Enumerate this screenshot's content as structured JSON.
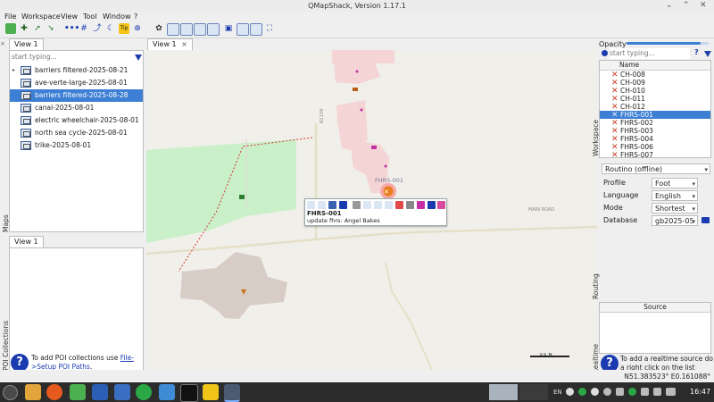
{
  "window": {
    "title": "QMapShack, Version 1.17.1"
  },
  "menu": [
    "File",
    "Workspace",
    "View",
    "Tool",
    "Window",
    "?"
  ],
  "maps_panel": {
    "tab": "View 1",
    "search_placeholder": "start typing...",
    "dock_label": "Maps",
    "items": [
      {
        "label": "barriers filtered-2025-08-21",
        "selected": false,
        "expander": true
      },
      {
        "label": "ave-verte-large-2025-08-01",
        "selected": false,
        "expander": false
      },
      {
        "label": "barriers filtered-2025-08-28",
        "selected": true,
        "expander": false
      },
      {
        "label": "canal-2025-08-01",
        "selected": false,
        "expander": false
      },
      {
        "label": "electric wheelchair-2025-08-01",
        "selected": false,
        "expander": false
      },
      {
        "label": "north sea cycle-2025-08-01",
        "selected": false,
        "expander": false
      },
      {
        "label": "trike-2025-08-01",
        "selected": false,
        "expander": false
      }
    ]
  },
  "poi_panel": {
    "tab": "View 1",
    "dock_label": "POI Collections",
    "help_text": "To add POI collections use ",
    "help_link": "File->Setup POI Paths",
    "help_end": "."
  },
  "map_view": {
    "tab": "View 1",
    "tab_close": "×",
    "road_label_1": "B1139",
    "road_label_2": "MAIN ROAD",
    "marker_label": "FHRS-001",
    "popup": {
      "title": "FHRS-001",
      "subtitle": "update fhrs: Angel Bakes"
    },
    "scale": "33 ft"
  },
  "workspace": {
    "opacity_label": "Opacity",
    "opacity_value": 0.9,
    "search_placeholder": "start typing...",
    "help_glyph": "?",
    "dock_label": "Workspace",
    "column_name": "Name",
    "items": [
      {
        "label": "CH-008",
        "selected": false
      },
      {
        "label": "CH-009",
        "selected": false
      },
      {
        "label": "CH-010",
        "selected": false
      },
      {
        "label": "CH-011",
        "selected": false
      },
      {
        "label": "CH-012",
        "selected": false
      },
      {
        "label": "FHRS-001",
        "selected": true
      },
      {
        "label": "FHRS-002",
        "selected": false
      },
      {
        "label": "FHRS-003",
        "selected": false
      },
      {
        "label": "FHRS-004",
        "selected": false
      },
      {
        "label": "FHRS-006",
        "selected": false
      },
      {
        "label": "FHRS-007",
        "selected": false
      }
    ]
  },
  "routing": {
    "dock_label": "Routing",
    "engine": "Routino (offline)",
    "profile_label": "Profile",
    "profile": "Foot",
    "language_label": "Language",
    "language": "English",
    "mode_label": "Mode",
    "mode": "Shortest",
    "database_label": "Database",
    "database": "gb2025-05"
  },
  "realtime": {
    "dock_label": "Realtime",
    "column_source": "Source",
    "help_text": "To add a realtime source do a right click on the list above."
  },
  "status": {
    "coordinates": "N51.383523° E0.161088°"
  },
  "taskbar": {
    "lang": "EN",
    "clock": "16:47"
  },
  "colors": {
    "accent": "#3d7fd4",
    "help_blue": "#1a3bb0",
    "poi_red": "#c83b1d"
  }
}
